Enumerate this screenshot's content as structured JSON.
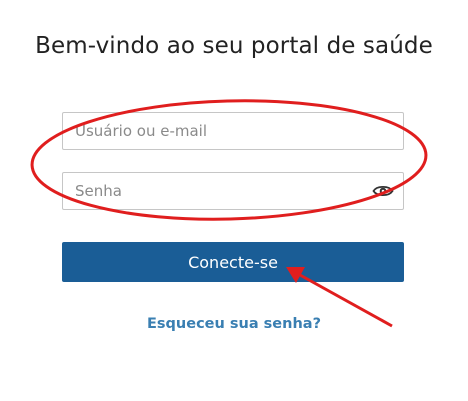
{
  "page": {
    "title": "Bem-vindo ao seu portal de saúde"
  },
  "login": {
    "username_placeholder": "Usuário ou e-mail",
    "password_placeholder": "Senha",
    "submit_label": "Conecte-se",
    "forgot_label": "Esqueceu sua senha?"
  },
  "icons": {
    "password_toggle": "eye-icon"
  },
  "annotations": {
    "color": "#e01e1e",
    "shapes": [
      "ellipse around fields",
      "arrow pointing to submit button"
    ]
  },
  "colors": {
    "primary_button": "#1a5d96",
    "link": "#3a7fb2"
  }
}
